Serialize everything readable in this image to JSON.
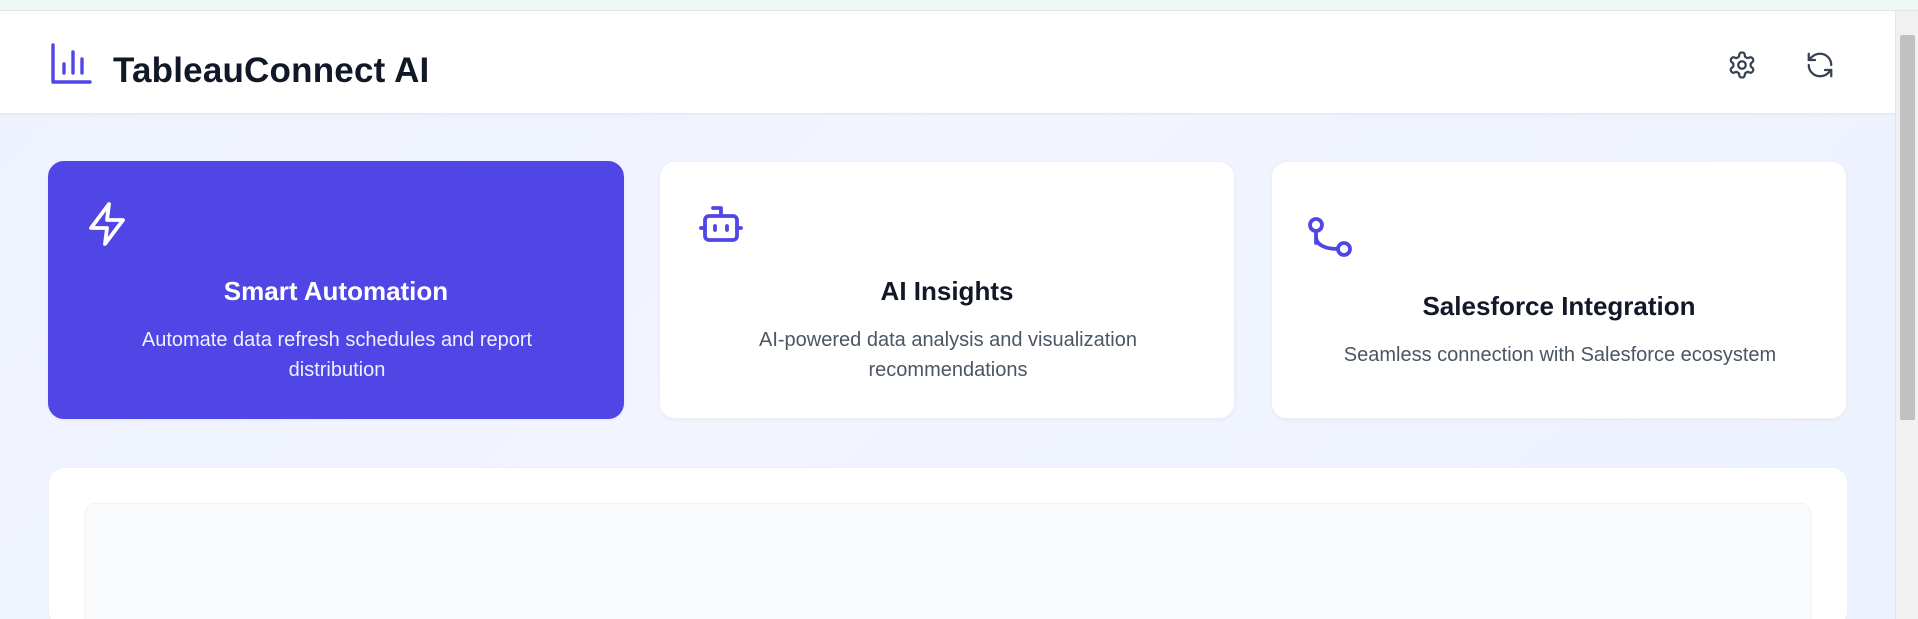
{
  "app": {
    "title": "TableauConnect AI",
    "logo_icon": "bar-chart-icon",
    "accent_color": "#5046e5"
  },
  "header": {
    "actions": [
      {
        "name": "settings",
        "icon": "gear-icon"
      },
      {
        "name": "refresh",
        "icon": "refresh-icon"
      }
    ]
  },
  "features": [
    {
      "title": "Smart Automation",
      "description": "Automate data refresh schedules and report distribution",
      "icon": "lightning-icon",
      "active": true
    },
    {
      "title": "AI Insights",
      "description": "AI-powered data analysis and visualization recommendations",
      "icon": "robot-icon",
      "active": false
    },
    {
      "title": "Salesforce Integration",
      "description": "Seamless connection with Salesforce ecosystem",
      "icon": "git-branch-icon",
      "active": false
    }
  ]
}
